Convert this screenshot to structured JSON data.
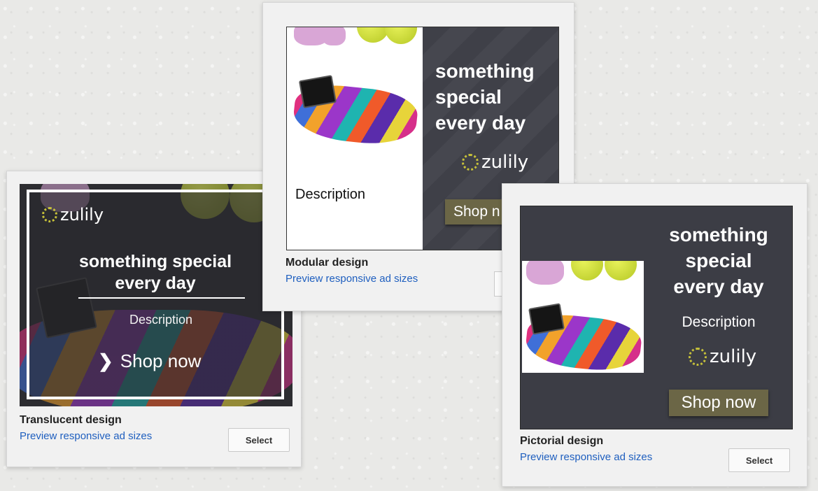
{
  "cards": {
    "translucent": {
      "title": "Translucent design",
      "preview_link": "Preview responsive ad sizes",
      "select_label": "Select",
      "ad": {
        "brand": "zulily",
        "headline": "something special every day",
        "description": "Description",
        "cta_icon": "chevron-right-icon",
        "cta": "Shop now"
      }
    },
    "modular": {
      "title": "Modular design",
      "preview_link": "Preview responsive ad sizes",
      "ad": {
        "description": "Description",
        "headline_lines": [
          "something",
          "special",
          "every day"
        ],
        "brand": "zulily",
        "cta": "Shop n"
      }
    },
    "pictorial": {
      "title": "Pictorial design",
      "preview_link": "Preview responsive ad sizes",
      "select_label": "Select",
      "ad": {
        "headline_lines": [
          "something",
          "special",
          "every day"
        ],
        "description": "Description",
        "brand": "zulily",
        "cta": "Shop now"
      }
    }
  },
  "colors": {
    "link": "#1f5fbf",
    "ad_dark_bg": "#3c3d45",
    "cta_bg": "#6b6646",
    "brand_flower": "#c7c23a"
  }
}
